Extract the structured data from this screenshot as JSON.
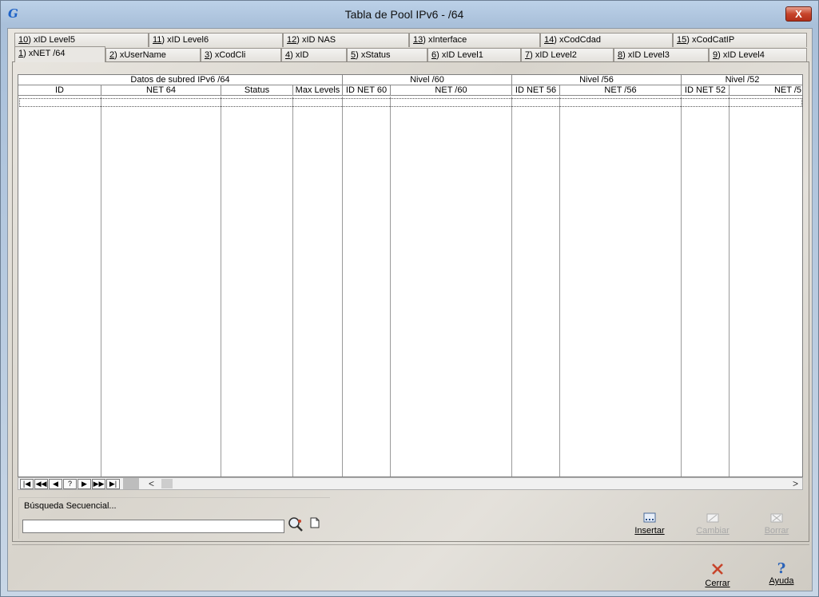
{
  "window": {
    "title": "Tabla de Pool IPv6 - /64",
    "close_glyph": "X"
  },
  "tabs_row_top": [
    {
      "num": "10",
      "label": ") xID Level5"
    },
    {
      "num": "11",
      "label": ") xID Level6"
    },
    {
      "num": "12",
      "label": ") xID NAS"
    },
    {
      "num": "13",
      "label": ") xInterface"
    },
    {
      "num": "14",
      "label": ") xCodCdad"
    },
    {
      "num": "15",
      "label": ") xCodCatIP"
    }
  ],
  "tabs_row_bottom": [
    {
      "num": "1",
      "label": ") xNET /64",
      "active": true
    },
    {
      "num": "2",
      "label": ") xUserName"
    },
    {
      "num": "3",
      "label": ") xCodCli"
    },
    {
      "num": "4",
      "label": ") xID"
    },
    {
      "num": "5",
      "label": ") xStatus"
    },
    {
      "num": "6",
      "label": ") xID Level1"
    },
    {
      "num": "7",
      "label": ") xID Level2"
    },
    {
      "num": "8",
      "label": ") xID Level3"
    },
    {
      "num": "9",
      "label": ") xID Level4"
    }
  ],
  "grid": {
    "groups": [
      "Datos de subred IPv6 /64",
      "Nivel /60",
      "Nivel /56",
      "Nivel /52"
    ],
    "columns": [
      "ID",
      "NET 64",
      "Status",
      "Max Levels",
      "ID NET 60",
      "NET /60",
      "ID NET 56",
      "NET /56",
      "ID NET 52",
      "NET /5"
    ],
    "rows": []
  },
  "navigator": {
    "first": "|◀",
    "prev_page": "◀◀",
    "prev": "◀",
    "find": "?",
    "next": "▶",
    "next_page": "▶▶",
    "last": "▶|",
    "scroll_left": "<",
    "scroll_right": ">"
  },
  "search": {
    "label": "Búsqueda Secuencial...",
    "value": "",
    "search_icon": "magnifier-icon",
    "clear_icon": "new-document-icon"
  },
  "actions": {
    "insert": {
      "label": "Insertar",
      "enabled": true,
      "icon": "insert-icon"
    },
    "change": {
      "label": "Cambiar",
      "enabled": false,
      "icon": "edit-icon"
    },
    "delete": {
      "label": "Borrar",
      "enabled": false,
      "icon": "delete-icon"
    }
  },
  "footer": {
    "close": {
      "label": "Cerrar",
      "icon": "close-x-icon"
    },
    "help": {
      "label": "Ayuda",
      "icon": "help-icon"
    }
  },
  "colors": {
    "close_red": "#c7442b",
    "help_blue": "#2a62b8"
  }
}
